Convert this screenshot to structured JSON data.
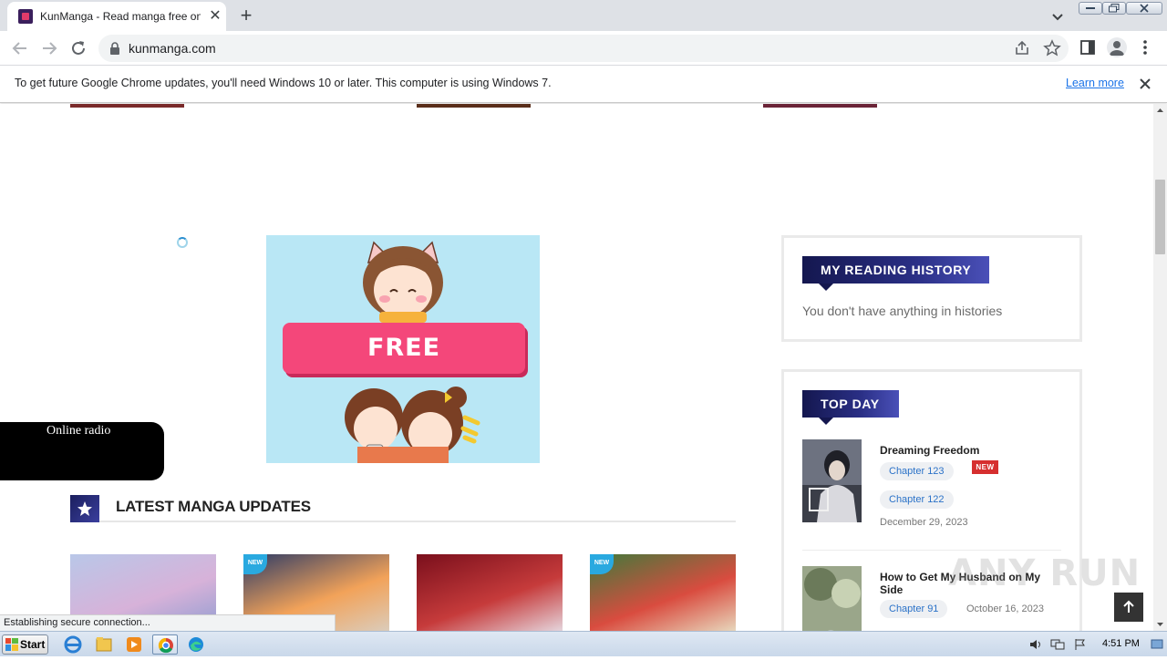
{
  "browser": {
    "tab_title": "KunManga - Read manga free online",
    "url": "kunmanga.com"
  },
  "infobar": {
    "message": "To get future Google Chrome updates, you'll need Windows 10 or later. This computer is using Windows 7.",
    "learn_more": "Learn more"
  },
  "ad": {
    "button": "FREE"
  },
  "radio": {
    "label": "Online radio"
  },
  "latest": {
    "title": "LATEST MANGA UPDATES",
    "new_badge": "NEW",
    "cards": [
      {
        "colors": [
          "#b9c7e8",
          "#d7b2d9",
          "#8a9bd0"
        ],
        "new": false
      },
      {
        "colors": [
          "#2d3b66",
          "#f2a259",
          "#d9d0c4"
        ],
        "new": true
      },
      {
        "colors": [
          "#7a0f1c",
          "#c63b3b",
          "#e8e4ec"
        ],
        "new": false
      },
      {
        "colors": [
          "#3f7a3b",
          "#d94c3f",
          "#e9e4c8"
        ],
        "new": true
      }
    ]
  },
  "history": {
    "title": "MY READING HISTORY",
    "empty": "You don't have anything in histories"
  },
  "topday": {
    "title": "TOP DAY",
    "items": [
      {
        "title": "Dreaming Freedom",
        "chapters": [
          "Chapter 123",
          "Chapter 122"
        ],
        "badge": "NEW",
        "date": "December 29, 2023"
      },
      {
        "title": "How to Get My Husband on My Side",
        "chapters": [
          "Chapter 91"
        ],
        "date": "October 16, 2023"
      }
    ]
  },
  "status": {
    "text": "Establishing secure connection..."
  },
  "watermark": "ANY RUN",
  "taskbar": {
    "start": "Start",
    "clock": "4:51 PM"
  },
  "colors": {
    "accent_navy": "#14174f",
    "chip_text": "#2b72c8",
    "ad_pink": "#f4477a"
  }
}
